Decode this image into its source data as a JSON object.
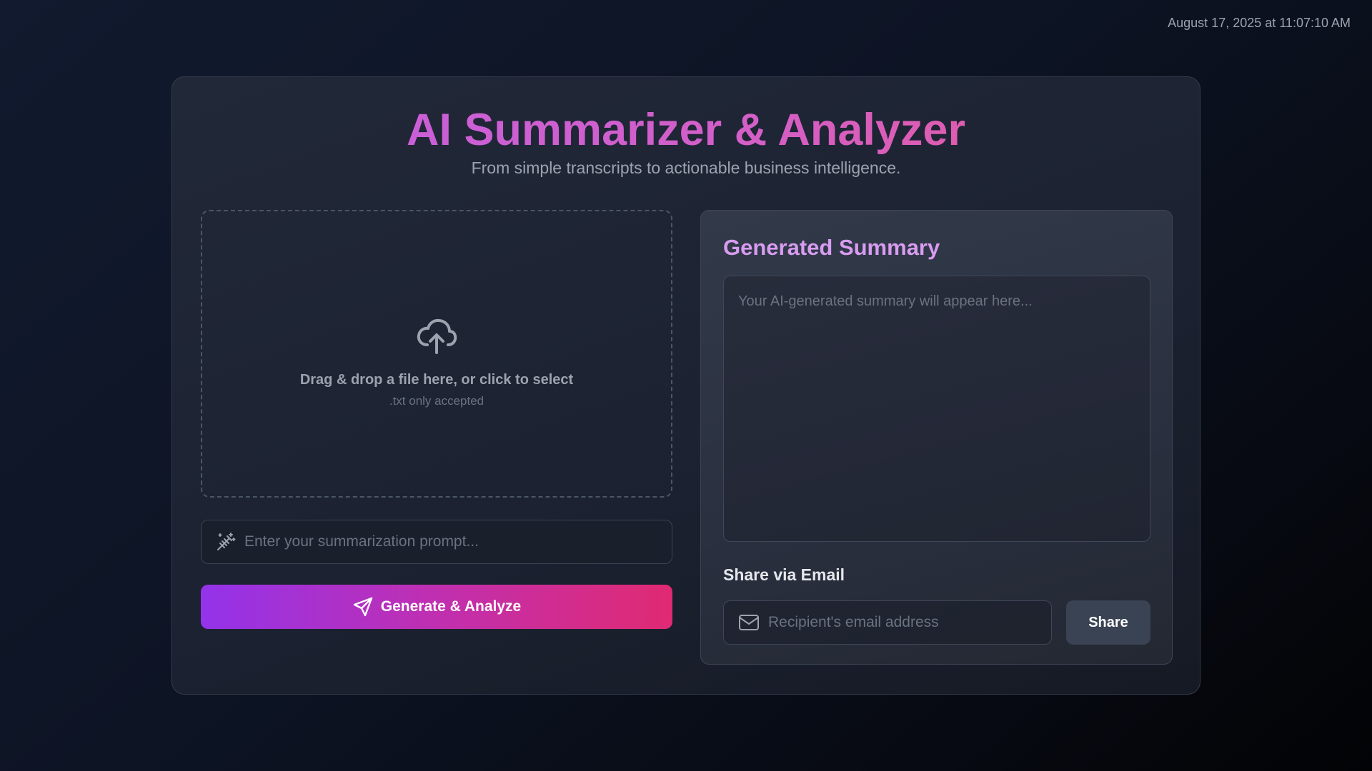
{
  "header": {
    "timestamp": "August 17, 2025 at 11:07:10 AM"
  },
  "app": {
    "title": "AI Summarizer & Analyzer",
    "subtitle": "From simple transcripts to actionable business intelligence."
  },
  "upload": {
    "icon": "cloud-upload-icon",
    "label": "Drag & drop a file here, or click to select",
    "hint": ".txt only accepted"
  },
  "prompt": {
    "icon": "magic-wand-icon",
    "placeholder": "Enter your summarization prompt...",
    "value": ""
  },
  "generate": {
    "icon": "send-icon",
    "label": "Generate & Analyze"
  },
  "summary": {
    "title": "Generated Summary",
    "placeholder": "Your AI-generated summary will appear here..."
  },
  "share": {
    "title": "Share via Email",
    "icon": "mail-icon",
    "email_placeholder": "Recipient's email address",
    "email_value": "",
    "button_label": "Share"
  },
  "colors": {
    "title_gradient": [
      "#c25fe0",
      "#e85a98"
    ],
    "button_gradient": [
      "#9333ea",
      "#e02a72"
    ],
    "summary_title": "#d89cf0",
    "share_button": "#3a4354"
  }
}
